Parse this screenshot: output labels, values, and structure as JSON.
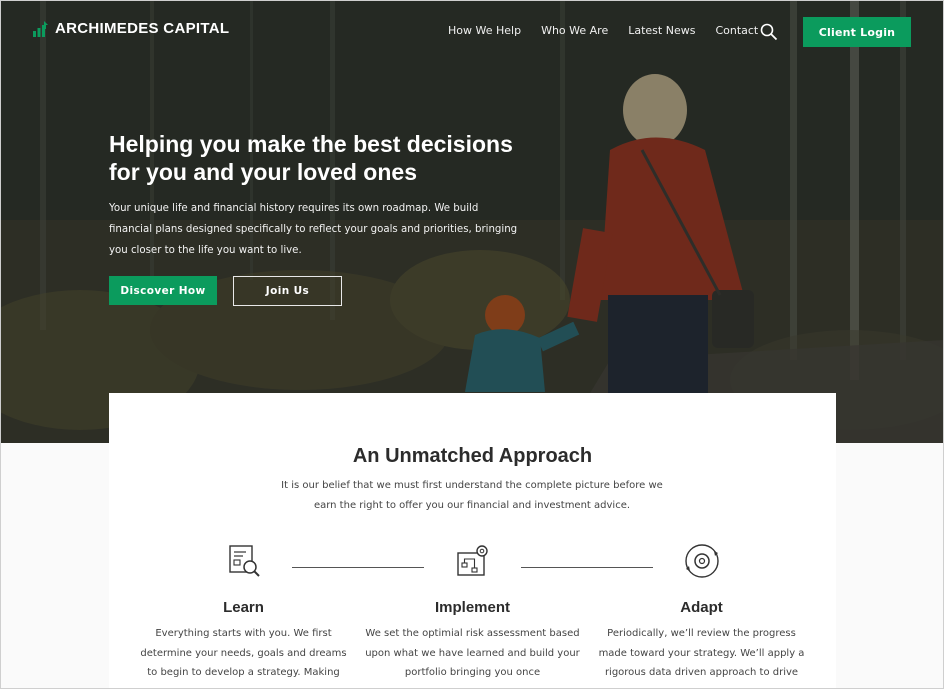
{
  "brand": {
    "name": "ARCHIMEDES CAPITAL",
    "accent": "#0b9b5d"
  },
  "nav": {
    "links": [
      "How We Help",
      "Who We Are",
      "Latest News",
      "Contact"
    ],
    "search_icon": "search-icon",
    "login_label": "Client Login"
  },
  "hero": {
    "title": "Helping you make the best decisions for you and your loved ones",
    "description": "Your unique life and financial history requires its own roadmap. We build financial plans designed specifically to reflect your goals and priorities, bringing you closer to the life you want to live.",
    "primary_cta": "Discover How",
    "secondary_cta": "Join Us"
  },
  "approach": {
    "title": "An Unmatched Approach",
    "description": "It is our belief that we must first understand the complete picture before we earn the right to offer you our financial and investment advice.",
    "steps": [
      {
        "icon": "document-magnifier-icon",
        "title": "Learn",
        "text": "Everything starts with you. We first determine your needs, goals and dreams to begin to develop a strategy. Making"
      },
      {
        "icon": "flowchart-gear-icon",
        "title": "Implement",
        "text": "We set the optimial risk assessment based upon what we have learned and build your portfolio bringing you once"
      },
      {
        "icon": "cycle-gear-icon",
        "title": "Adapt",
        "text": "Periodically, we’ll review the progress made toward your strategy. We’ll apply a rigorous data driven approach to drive"
      }
    ]
  }
}
